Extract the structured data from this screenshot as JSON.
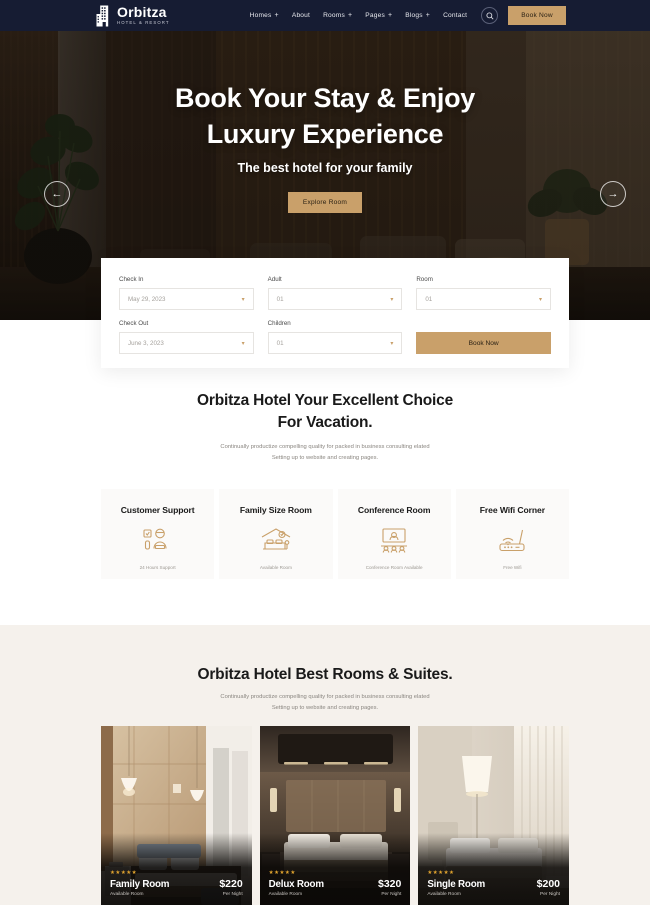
{
  "header": {
    "logo": {
      "name": "Orbitza",
      "subtitle": "HOTEL & RESORT",
      "icon": "building-icon"
    },
    "nav": [
      {
        "label": "Homes",
        "has_dropdown": true
      },
      {
        "label": "About",
        "has_dropdown": false
      },
      {
        "label": "Rooms",
        "has_dropdown": true
      },
      {
        "label": "Pages",
        "has_dropdown": true
      },
      {
        "label": "Blogs",
        "has_dropdown": true
      },
      {
        "label": "Contact",
        "has_dropdown": false
      }
    ],
    "search_icon": "search-icon",
    "book_now": "Book Now"
  },
  "hero": {
    "title_line1": "Book Your Stay & Enjoy",
    "title_line2": "Luxury Experience",
    "subtitle": "The best hotel for your family",
    "cta": "Explore Room",
    "prev_icon": "arrow-left-icon",
    "next_icon": "arrow-right-icon"
  },
  "booking": {
    "fields": [
      {
        "label": "Check In",
        "value": "May 29, 2023"
      },
      {
        "label": "Adult",
        "value": "01"
      },
      {
        "label": "Room",
        "value": "01"
      },
      {
        "label": "Check Out",
        "value": "June 3, 2023"
      },
      {
        "label": "Children",
        "value": "01"
      }
    ],
    "submit": "Book Now"
  },
  "choice": {
    "title_line1": "Orbitza Hotel Your Excellent Choice",
    "title_line2": "For Vacation.",
    "desc_line1": "Continually productize compelling quality for packed in business consulting elated",
    "desc_line2": "Setting up to website and creating pages."
  },
  "features": [
    {
      "title": "Customer Support",
      "sub": "24 Hours Support",
      "icon": "support-agent-icon"
    },
    {
      "title": "Family Size Room",
      "sub": "Available Room",
      "icon": "family-bed-icon"
    },
    {
      "title": "Conference Room",
      "sub": "Conference Room Available",
      "icon": "conference-icon"
    },
    {
      "title": "Free Wifi Corner",
      "sub": "Free Wifi",
      "icon": "wifi-router-icon"
    }
  ],
  "rooms": {
    "title": "Orbitza Hotel Best Rooms & Suites.",
    "desc_line1": "Continually productize compelling quality for packed in business consulting elated",
    "desc_line2": "Setting up to website and creating pages.",
    "cards": [
      {
        "name": "Family Room",
        "availability": "Available Room",
        "price": "$220",
        "period": "Per Night",
        "stars": "★★★★★"
      },
      {
        "name": "Delux Room",
        "availability": "Available Room",
        "price": "$320",
        "period": "Per Night",
        "stars": "★★★★★"
      },
      {
        "name": "Single Room",
        "availability": "Available Room",
        "price": "$200",
        "period": "Per Night",
        "stars": "★★★★★"
      }
    ]
  },
  "colors": {
    "header_bg": "#161c33",
    "accent_gold": "#c9a06a",
    "section_cream": "#f5f1ec",
    "card_bg": "#fbfaf9",
    "star_gold": "#e0a32e"
  }
}
